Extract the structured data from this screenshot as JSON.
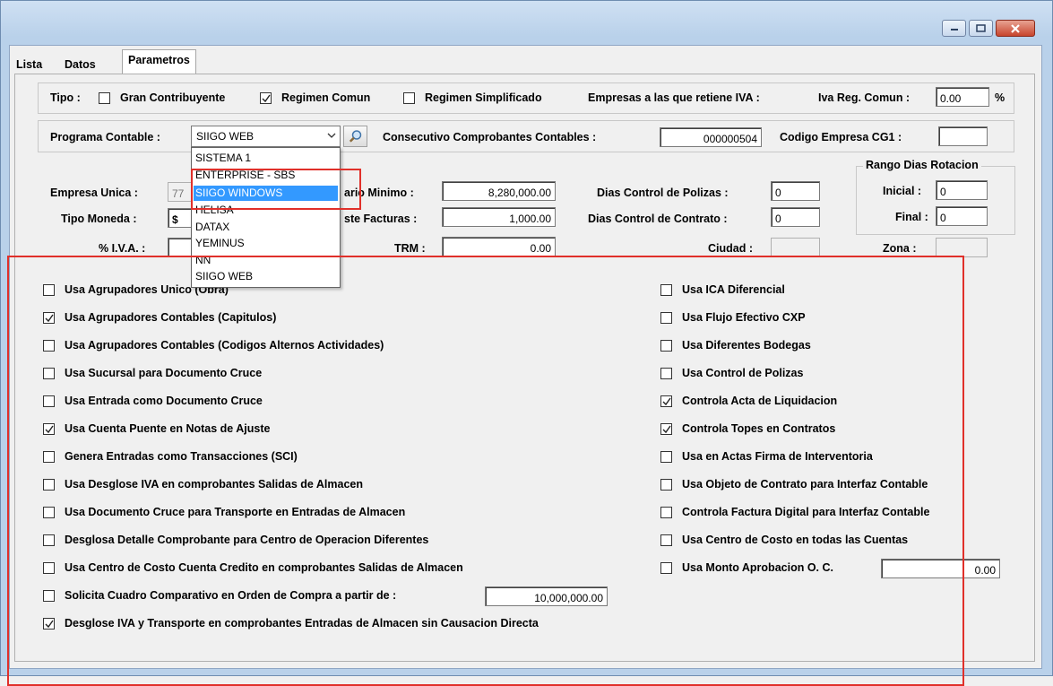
{
  "tabs": [
    {
      "label": "Lista"
    },
    {
      "label": "Datos"
    },
    {
      "label": "Parametros Contables y de Control"
    }
  ],
  "tipo": {
    "label": "Tipo :",
    "gran_contribuyente": {
      "label": "Gran Contribuyente",
      "checked": false
    },
    "regimen_comun": {
      "label": "Regimen Comun",
      "checked": true
    },
    "regimen_simplificado": {
      "label": "Regimen Simplificado",
      "checked": false
    },
    "retiene_iva_label": "Empresas a las que retiene IVA :",
    "iva_reg_comun_label": "Iva Reg. Comun :",
    "iva_reg_comun_value": "0.00",
    "percent": "%"
  },
  "programa": {
    "label": "Programa Contable :",
    "selected": "SIIGO WEB",
    "options": [
      "SISTEMA 1",
      "ENTERPRISE - SBS",
      "SIIGO WINDOWS",
      "HELISA",
      "DATAX",
      "YEMINUS",
      "NN",
      "SIIGO WEB"
    ],
    "highlighted": "SIIGO WINDOWS",
    "consecutivo_label": "Consecutivo Comprobantes Contables :",
    "consecutivo_value": "000000504",
    "codigo_cg1_label": "Codigo Empresa CG1 :",
    "codigo_cg1_value": ""
  },
  "fields": {
    "empresa_unica_label": "Empresa Unica :",
    "empresa_unica_value": "77",
    "tipo_moneda_label": "Tipo Moneda :",
    "tipo_moneda_value": "$",
    "iva_label": "% I.V.A. :",
    "iva_value": "",
    "salario_minimo_label": "ario Minimo :",
    "salario_minimo_value": "8,280,000.00",
    "ajuste_facturas_label": "ste Facturas :",
    "ajuste_facturas_value": "1,000.00",
    "trm_label": "TRM :",
    "trm_value": "0.00",
    "dias_polizas_label": "Dias Control de Polizas :",
    "dias_polizas_value": "0",
    "dias_contrato_label": "Dias Control de Contrato :",
    "dias_contrato_value": "0",
    "ciudad_label": "Ciudad :",
    "ciudad_value": "",
    "rango_label": "Rango Dias Rotacion",
    "inicial_label": "Inicial :",
    "inicial_value": "0",
    "final_label": "Final :",
    "final_value": "0",
    "zona_label": "Zona :",
    "zona_value": ""
  },
  "left_checks": [
    {
      "label": "Usa Agrupadores Unico (Obra)",
      "checked": false
    },
    {
      "label": "Usa Agrupadores Contables (Capitulos)",
      "checked": true
    },
    {
      "label": "Usa Agrupadores Contables (Codigos Alternos Actividades)",
      "checked": false
    },
    {
      "label": "Usa Sucursal para Documento Cruce",
      "checked": false
    },
    {
      "label": "Usa Entrada como Documento Cruce",
      "checked": false
    },
    {
      "label": "Usa Cuenta Puente en Notas de Ajuste",
      "checked": true
    },
    {
      "label": "Genera Entradas como Transacciones (SCI)",
      "checked": false
    },
    {
      "label": "Usa Desglose IVA en comprobantes Salidas de Almacen",
      "checked": false
    },
    {
      "label": "Usa Documento Cruce para Transporte en Entradas de Almacen",
      "checked": false
    },
    {
      "label": "Desglosa Detalle Comprobante para Centro de Operacion Diferentes",
      "checked": false
    },
    {
      "label": "Usa Centro de Costo Cuenta Credito en comprobantes Salidas de Almacen",
      "checked": false
    },
    {
      "label": "Solicita Cuadro Comparativo en Orden de Compra a partir de :",
      "checked": false
    },
    {
      "label": "Desglose IVA y Transporte en comprobantes Entradas de Almacen sin Causacion Directa",
      "checked": true
    }
  ],
  "solicita_value": "10,000,000.00",
  "right_checks": [
    {
      "label": "Usa ICA Diferencial",
      "checked": false
    },
    {
      "label": "Usa Flujo Efectivo CXP",
      "checked": false
    },
    {
      "label": "Usa Diferentes Bodegas",
      "checked": false
    },
    {
      "label": "Usa Control de Polizas",
      "checked": false
    },
    {
      "label": "Controla Acta de Liquidacion",
      "checked": true
    },
    {
      "label": "Controla Topes en Contratos",
      "checked": true
    },
    {
      "label": "Usa en Actas Firma de Interventoria",
      "checked": false
    },
    {
      "label": "Usa Objeto de Contrato para Interfaz Contable",
      "checked": false
    },
    {
      "label": "Controla Factura Digital para Interfaz Contable",
      "checked": false
    },
    {
      "label": "Usa Centro de Costo en todas las Cuentas",
      "checked": false
    },
    {
      "label": "Usa Monto Aprobacion O. C.",
      "checked": false
    }
  ],
  "monto_aprobacion_value": "0.00",
  "colors": {
    "highlight": "#3399ff",
    "annotation": "#e0302a"
  }
}
